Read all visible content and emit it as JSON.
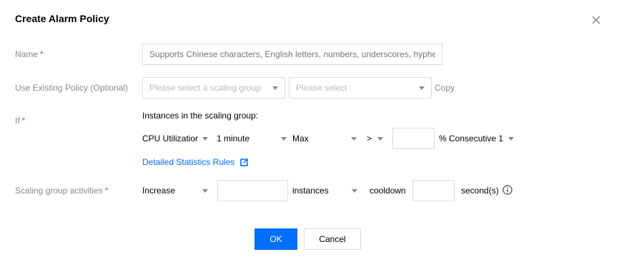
{
  "dialog": {
    "title": "Create Alarm Policy"
  },
  "form": {
    "name": {
      "label": "Name",
      "required_mark": "*",
      "placeholder": "Supports Chinese characters, English letters, numbers, underscores, hyphe"
    },
    "existing_policy": {
      "label": "Use Existing Policy (Optional)",
      "group_select_placeholder": "Please select a scaling group",
      "policy_select_placeholder": "Please select",
      "copy_label": "Copy"
    },
    "condition": {
      "label": "If",
      "required_mark": "*",
      "intro": "Instances in the scaling group:",
      "metric": "CPU Utilizatior",
      "period": "1 minute",
      "statistic": "Max",
      "operator": ">",
      "threshold_value": "",
      "unit": "%",
      "consecutive": "Consecutive 1",
      "stats_rules_link": "Detailed Statistics Rules"
    },
    "activity": {
      "label": "Scaling group activities",
      "required_mark": "*",
      "action": "Increase",
      "amount_value": "",
      "amount_unit": "instances",
      "cooldown_label": "cooldown",
      "cooldown_value": "",
      "cooldown_unit": "second(s)"
    }
  },
  "footer": {
    "ok_label": "OK",
    "cancel_label": "Cancel"
  },
  "colors": {
    "primary": "#006eff",
    "required": "#e54545",
    "label": "#888888",
    "border": "#dddddd"
  },
  "icons": [
    "close-icon",
    "caret-down-icon",
    "external-link-icon",
    "info-icon"
  ]
}
